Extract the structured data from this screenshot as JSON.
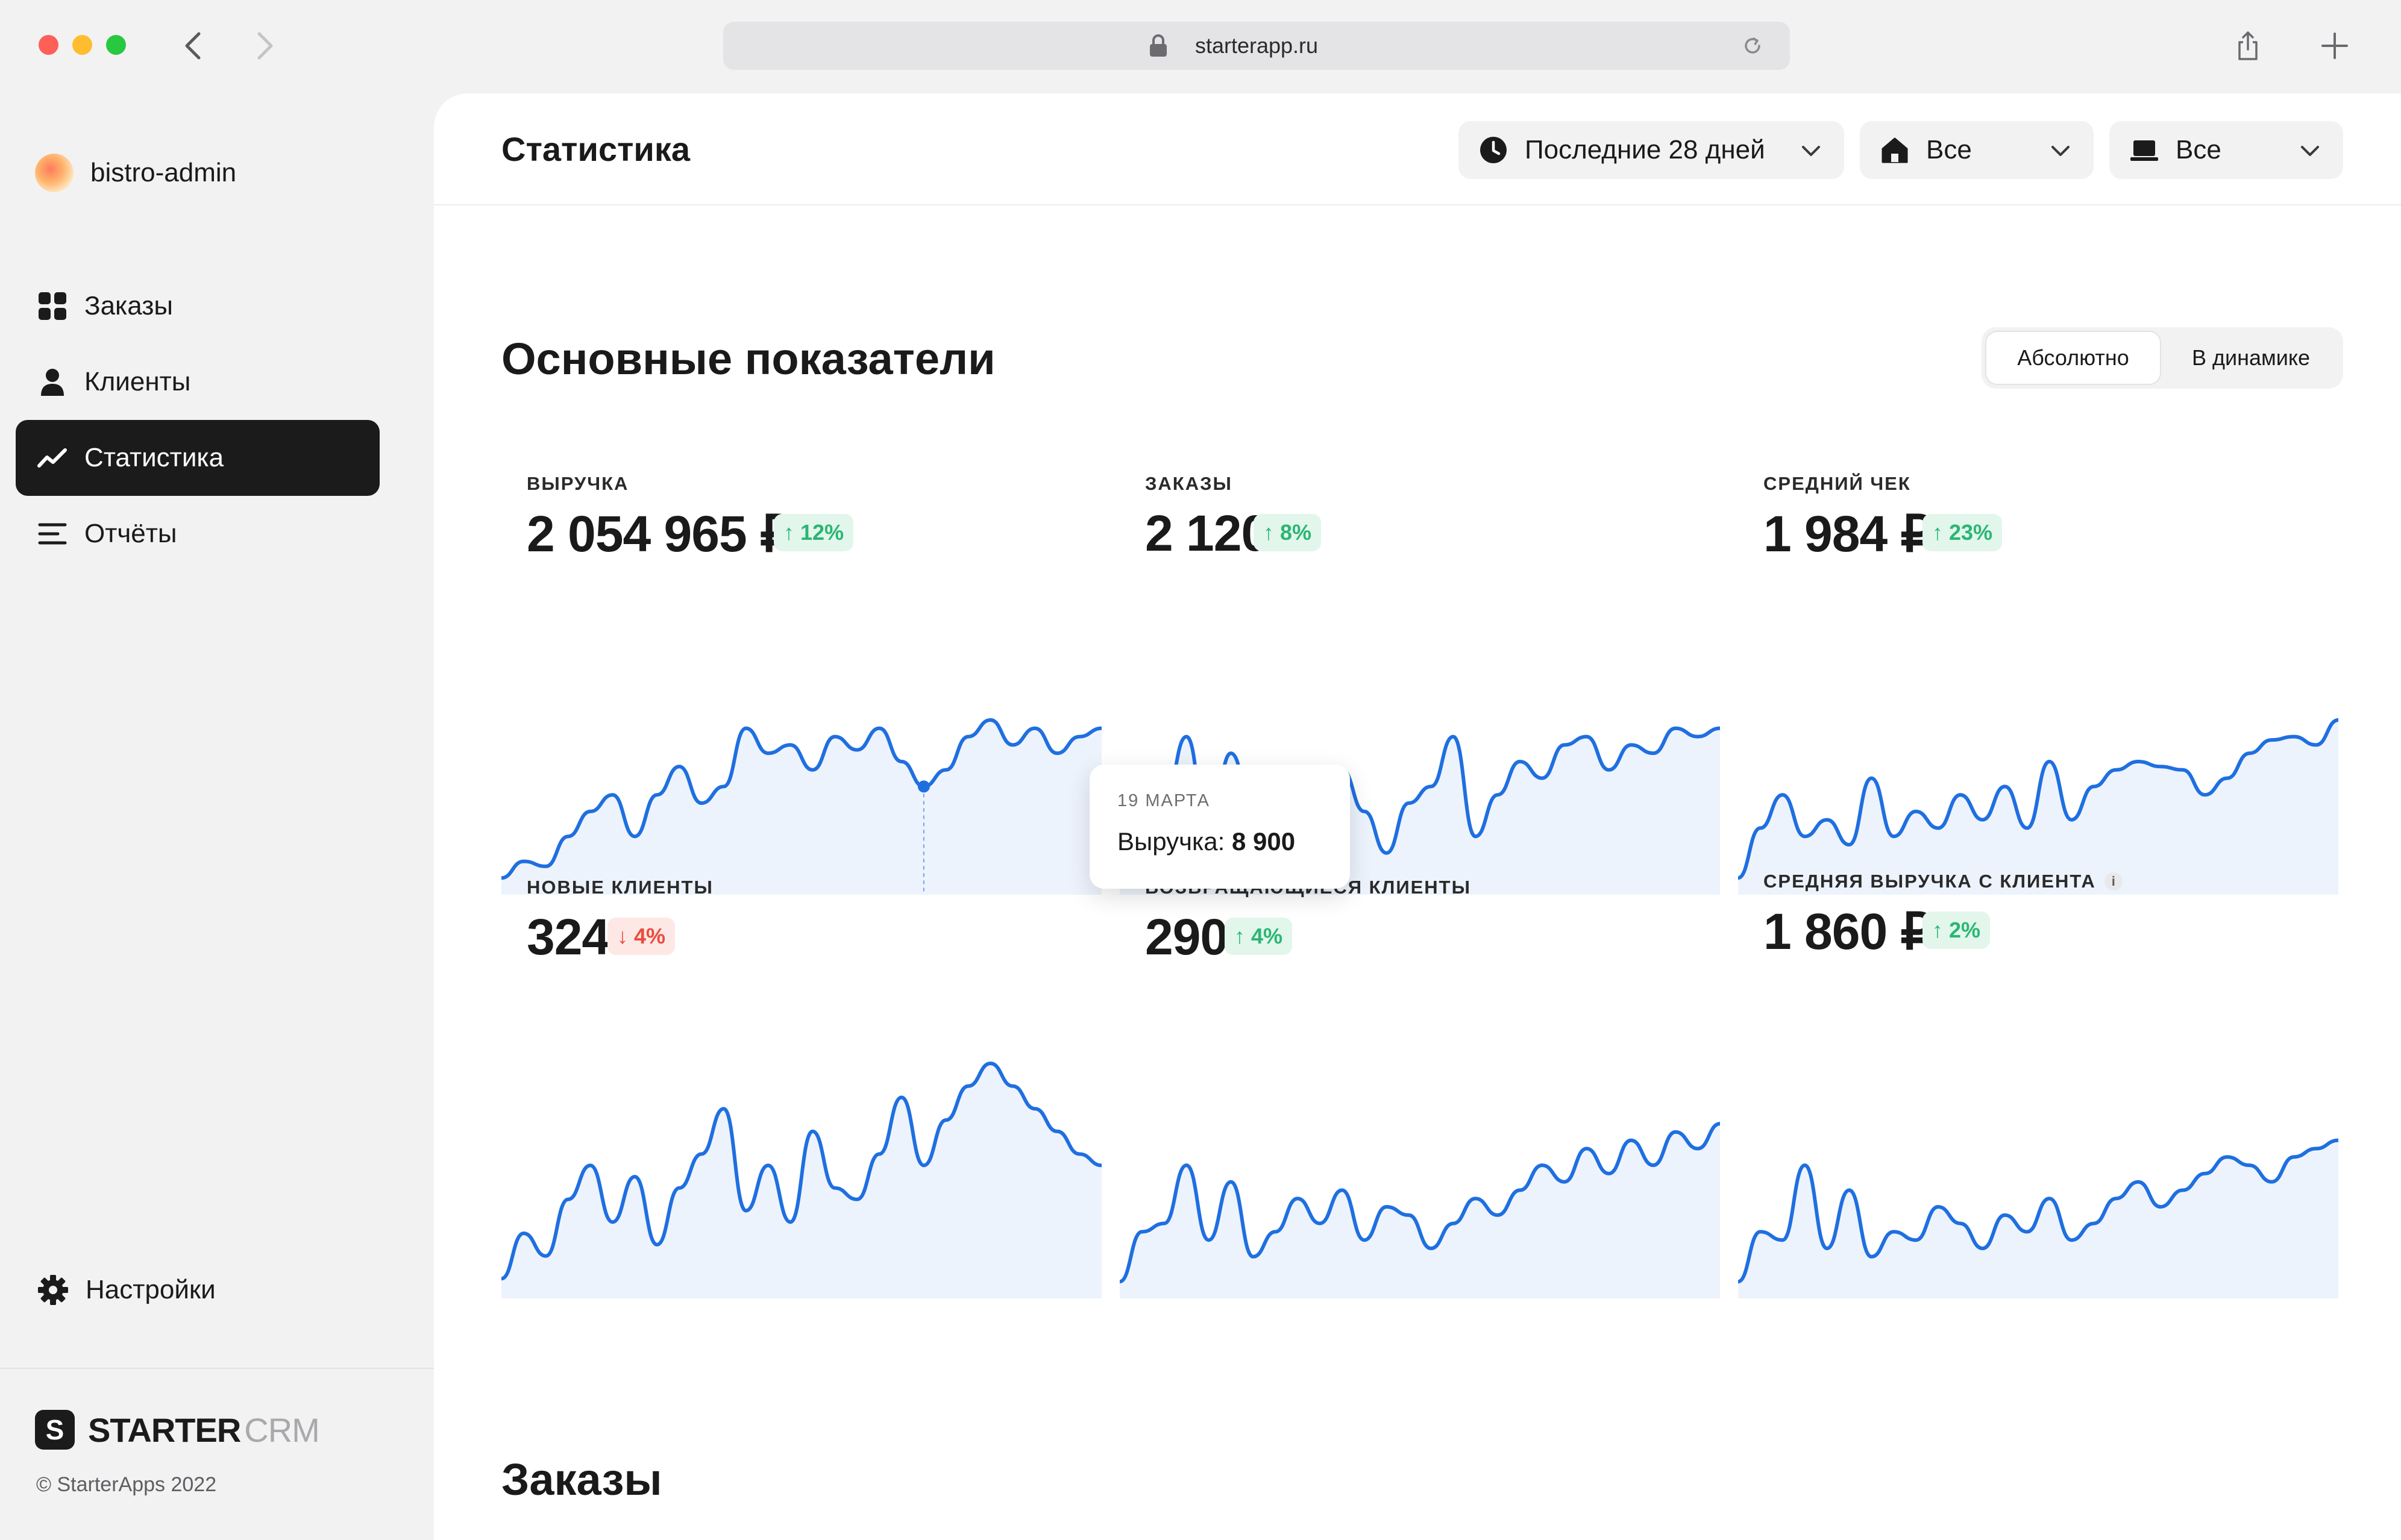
{
  "browser": {
    "url": "starterapp.ru"
  },
  "sidebar": {
    "account": "bistro-admin",
    "items": [
      {
        "label": "Заказы",
        "icon": "grid-icon",
        "active": false
      },
      {
        "label": "Клиенты",
        "icon": "user-icon",
        "active": false
      },
      {
        "label": "Статистика",
        "icon": "trend-icon",
        "active": true
      },
      {
        "label": "Отчёты",
        "icon": "list-icon",
        "active": false
      }
    ],
    "settings": "Настройки",
    "brand_bold": "STARTER",
    "brand_light": "CRM",
    "copyright": "© StarterApps 2022"
  },
  "header": {
    "title": "Статистика",
    "filters": {
      "period": "Последние 28 дней",
      "place": "Все",
      "device": "Все"
    }
  },
  "main": {
    "section_title": "Основные показатели",
    "toggle": {
      "absolute": "Абсолютно",
      "dynamic": "В динамике",
      "selected": "Абсолютно"
    },
    "orders_title": "Заказы"
  },
  "metrics": [
    {
      "label": "ВЫРУЧКА",
      "value": "2 054 965 ₽",
      "change": "↑ 12%",
      "direction": "up"
    },
    {
      "label": "ЗАКАЗЫ",
      "value": "2 120",
      "change": "↑ 8%",
      "direction": "up"
    },
    {
      "label": "СРЕДНИЙ ЧЕК",
      "value": "1 984 ₽",
      "change": "↑ 23%",
      "direction": "up"
    },
    {
      "label": "НОВЫЕ КЛИЕНТЫ",
      "value": "324",
      "change": "↓ 4%",
      "direction": "down"
    },
    {
      "label": "ВОЗВРАЩАЮЩИЕСЯ КЛИЕНТЫ",
      "value": "290",
      "change": "↑ 4%",
      "direction": "up"
    },
    {
      "label": "СРЕДНЯЯ ВЫРУЧКА С КЛИЕНТА",
      "value": "1 860 ₽",
      "change": "↑ 2%",
      "direction": "up"
    }
  ],
  "tooltip": {
    "date": "19 МАРТА",
    "metric_label": "Выручка:",
    "metric_value": "8 900"
  },
  "colors": {
    "accent": "#1f6fe0",
    "area_fill": "#edf3fc",
    "up": "#2bb673",
    "down": "#ec4b3d",
    "active_nav": "#1b1b1b"
  },
  "chart_data": [
    {
      "type": "area",
      "series": [
        {
          "values": [
            0.05,
            0.15,
            0.12,
            0.3,
            0.45,
            0.55,
            0.3,
            0.55,
            0.72,
            0.5,
            0.6,
            0.95,
            0.8,
            0.85,
            0.7,
            0.9,
            0.82,
            0.95,
            0.75,
            0.6,
            0.7,
            0.9,
            1.0,
            0.85,
            0.95,
            0.8,
            0.9,
            0.95
          ]
        }
      ]
    },
    {
      "type": "area",
      "series": [
        {
          "values": [
            0.05,
            0.4,
            0.5,
            0.9,
            0.3,
            0.8,
            0.45,
            0.2,
            0.4,
            0.55,
            0.7,
            0.45,
            0.2,
            0.5,
            0.6,
            0.9,
            0.3,
            0.55,
            0.75,
            0.65,
            0.85,
            0.9,
            0.7,
            0.85,
            0.8,
            0.95,
            0.9,
            0.95
          ]
        }
      ]
    },
    {
      "type": "area",
      "series": [
        {
          "values": [
            0.05,
            0.35,
            0.55,
            0.3,
            0.4,
            0.25,
            0.65,
            0.3,
            0.45,
            0.35,
            0.55,
            0.4,
            0.6,
            0.35,
            0.75,
            0.4,
            0.6,
            0.7,
            0.75,
            0.72,
            0.7,
            0.55,
            0.65,
            0.8,
            0.88,
            0.9,
            0.85,
            1.0
          ]
        }
      ]
    },
    {
      "type": "area",
      "series": [
        {
          "values": [
            0.05,
            0.25,
            0.15,
            0.4,
            0.55,
            0.3,
            0.5,
            0.2,
            0.45,
            0.6,
            0.8,
            0.35,
            0.55,
            0.3,
            0.7,
            0.45,
            0.4,
            0.6,
            0.85,
            0.55,
            0.75,
            0.9,
            1.0,
            0.9,
            0.8,
            0.7,
            0.6,
            0.55
          ]
        }
      ]
    },
    {
      "type": "area",
      "series": [
        {
          "values": [
            0.05,
            0.35,
            0.4,
            0.75,
            0.3,
            0.65,
            0.2,
            0.35,
            0.55,
            0.4,
            0.6,
            0.3,
            0.5,
            0.45,
            0.25,
            0.4,
            0.55,
            0.45,
            0.6,
            0.75,
            0.65,
            0.85,
            0.7,
            0.9,
            0.75,
            0.95,
            0.85,
            1.0
          ]
        }
      ]
    },
    {
      "type": "area",
      "series": [
        {
          "values": [
            0.05,
            0.35,
            0.3,
            0.75,
            0.25,
            0.6,
            0.2,
            0.35,
            0.3,
            0.5,
            0.4,
            0.25,
            0.45,
            0.35,
            0.55,
            0.3,
            0.4,
            0.55,
            0.65,
            0.5,
            0.6,
            0.7,
            0.8,
            0.75,
            0.65,
            0.8,
            0.85,
            0.9
          ]
        }
      ]
    }
  ]
}
